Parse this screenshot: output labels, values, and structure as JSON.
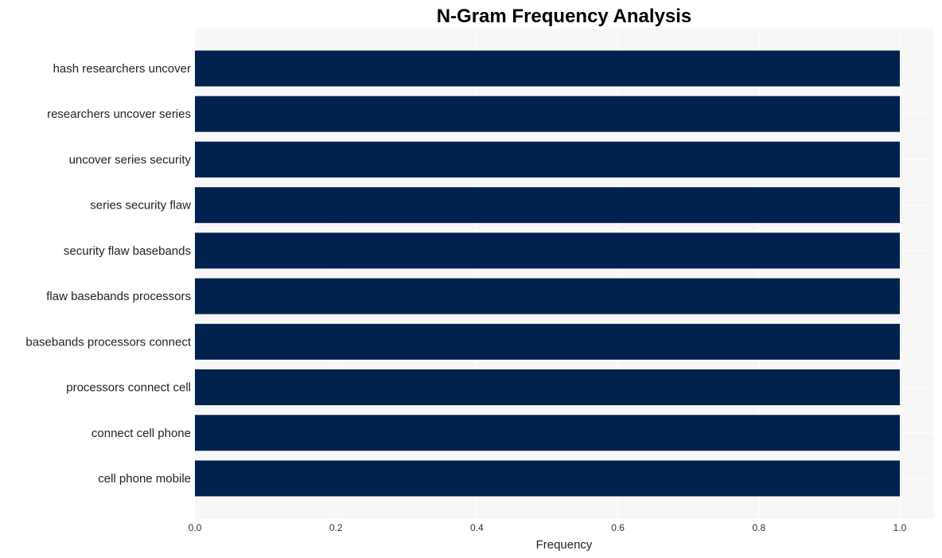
{
  "chart_data": {
    "type": "bar",
    "orientation": "horizontal",
    "title": "N-Gram Frequency Analysis",
    "xlabel": "Frequency",
    "ylabel": "",
    "categories": [
      "hash researchers uncover",
      "researchers uncover series",
      "uncover series security",
      "series security flaw",
      "security flaw basebands",
      "flaw basebands processors",
      "basebands processors connect",
      "processors connect cell",
      "connect cell phone",
      "cell phone mobile"
    ],
    "values": [
      1,
      1,
      1,
      1,
      1,
      1,
      1,
      1,
      1,
      1
    ],
    "xlim": [
      0,
      1.05
    ],
    "xticks": [
      0.0,
      0.2,
      0.4,
      0.6,
      0.8,
      1.0
    ],
    "xtick_labels": [
      "0.0",
      "0.2",
      "0.4",
      "0.6",
      "0.8",
      "1.0"
    ],
    "grid": true,
    "legend": "none",
    "colors": {
      "bar": "#00224e",
      "plot_background": "#f7f7f7",
      "grid": "#ffffff"
    }
  }
}
